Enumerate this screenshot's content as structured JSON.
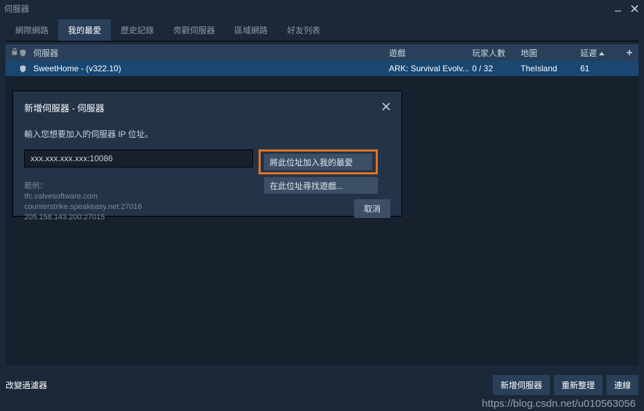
{
  "window": {
    "title": "伺服器"
  },
  "tabs": {
    "internet": "網際網路",
    "favorites": "我的最愛",
    "history": "歷史記錄",
    "spectate": "旁觀伺服器",
    "lan": "區域網路",
    "friends": "好友列表"
  },
  "columns": {
    "server": "伺服器",
    "game": "遊戲",
    "players": "玩家人數",
    "map": "地圖",
    "latency": "延遲"
  },
  "servers": [
    {
      "name": "SweetHome - (v322.10)",
      "game": "ARK: Survival Evolv...",
      "players": "0 / 32",
      "map": "TheIsland",
      "latency": "61"
    }
  ],
  "footer": {
    "change_filters": "改變過濾器",
    "add_server": "新增伺服器",
    "refresh": "重新整理",
    "connect": "連線"
  },
  "dialog": {
    "title": "新增伺服器 - 伺服器",
    "prompt": "輸入您想要加入的伺服器 IP 位址。",
    "ip_value": "xxx.xxx.xxx.xxx:10086",
    "add_to_favorites": "將此位址加入我的最愛",
    "find_games": "在此位址尋找遊戲...",
    "cancel": "取消",
    "example_header": "範例：",
    "examples": [
      "tfc.valvesoftware.com",
      "counterstrike.speakeasy.net:27016",
      "205.158.143.200:27015"
    ]
  },
  "watermark": "https://blog.csdn.net/u010563056"
}
